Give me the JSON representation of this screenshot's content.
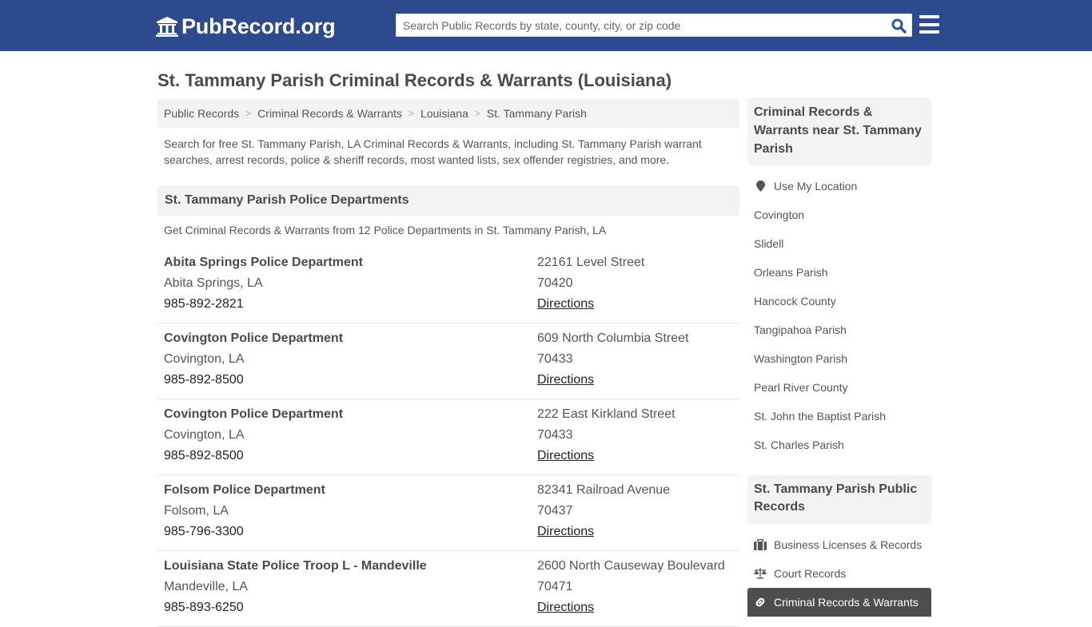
{
  "header": {
    "logo_text": "PubRecord.org",
    "search_placeholder": "Search Public Records by state, county, city, or zip code",
    "brand_color": "#2e4a8f"
  },
  "page": {
    "title": "St. Tammany Parish Criminal Records & Warrants (Louisiana)",
    "breadcrumb": [
      "Public Records",
      "Criminal Records & Warrants",
      "Louisiana",
      "St. Tammany Parish"
    ],
    "intro": "Search for free St. Tammany Parish, LA Criminal Records & Warrants, including St. Tammany Parish warrant searches, arrest records, police & sheriff records, most wanted lists, sex offender registries, and more."
  },
  "section": {
    "title": "St. Tammany Parish Police Departments",
    "subtitle": "Get Criminal Records & Warrants from 12 Police Departments in St. Tammany Parish, LA",
    "directions_label": "Directions",
    "departments": [
      {
        "name": "Abita Springs Police Department",
        "city": "Abita Springs, LA",
        "phone": "985-892-2821",
        "address": "22161 Level Street",
        "zip": "70420"
      },
      {
        "name": "Covington Police Department",
        "city": "Covington, LA",
        "phone": "985-892-8500",
        "address": "609 North Columbia Street",
        "zip": "70433"
      },
      {
        "name": "Covington Police Department",
        "city": "Covington, LA",
        "phone": "985-892-8500",
        "address": "222 East Kirkland Street",
        "zip": "70433"
      },
      {
        "name": "Folsom Police Department",
        "city": "Folsom, LA",
        "phone": "985-796-3300",
        "address": "82341 Railroad Avenue",
        "zip": "70437"
      },
      {
        "name": "Louisiana State Police Troop L - Mandeville",
        "city": "Mandeville, LA",
        "phone": "985-893-6250",
        "address": "2600 North Causeway Boulevard",
        "zip": "70471"
      }
    ]
  },
  "sidebar": {
    "nearby_title": "Criminal Records & Warrants near St. Tammany Parish",
    "use_location": "Use My Location",
    "nearby": [
      "Covington",
      "Slidell",
      "Orleans Parish",
      "Hancock County",
      "Tangipahoa Parish",
      "Washington Parish",
      "Pearl River County",
      "St. John the Baptist Parish",
      "St. Charles Parish"
    ],
    "records_title": "St. Tammany Parish Public Records",
    "records": [
      {
        "label": "Business Licenses & Records",
        "icon": "briefcase-icon",
        "active": false
      },
      {
        "label": "Court Records",
        "icon": "scale-icon",
        "active": false
      },
      {
        "label": "Criminal Records & Warrants",
        "icon": "link-icon",
        "active": true
      }
    ]
  }
}
